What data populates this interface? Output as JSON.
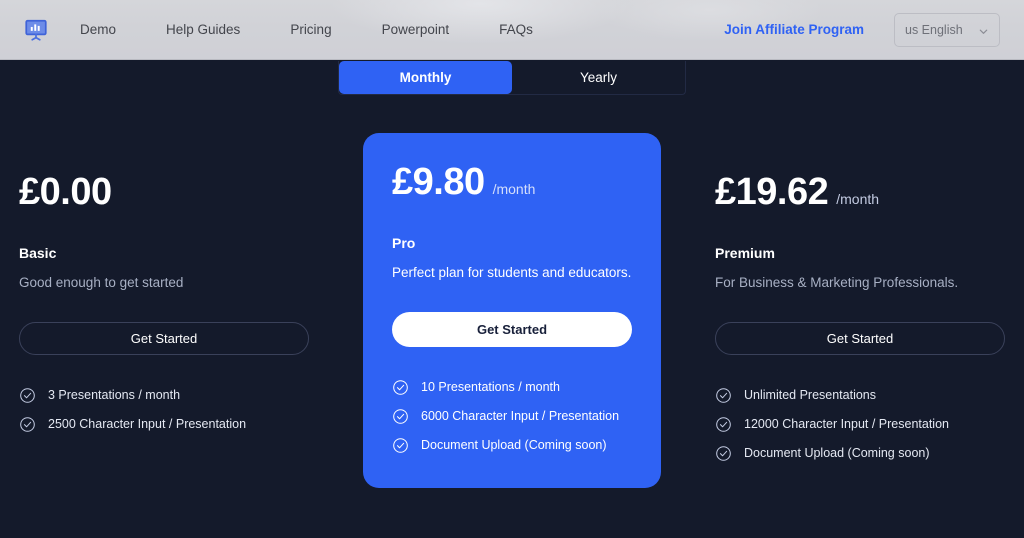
{
  "header": {
    "logo_icon": "presentation-chart-icon",
    "nav_links": [
      {
        "label": "Demo"
      },
      {
        "label": "Help Guides"
      },
      {
        "label": "Pricing"
      },
      {
        "label": "Powerpoint"
      },
      {
        "label": "FAQs"
      }
    ],
    "affiliate_label": "Join Affiliate Program",
    "language": {
      "selected": "us English",
      "chevron_icon": "chevron-down-icon"
    },
    "colors": {
      "background": "#d2d3d8",
      "link": "#43454c",
      "accent": "#2f62f4"
    }
  },
  "billing_toggle": {
    "options": [
      {
        "label": "Monthly",
        "active": true
      },
      {
        "label": "Yearly",
        "active": false
      }
    ]
  },
  "pricing": {
    "check_icon": "check-circle-icon",
    "plans": [
      {
        "price": "£0.00",
        "period": "",
        "name": "Basic",
        "description": "Good enough to get started",
        "cta_label": "Get Started",
        "featured": false,
        "features": [
          "3 Presentations / month",
          "2500 Character Input / Presentation"
        ]
      },
      {
        "price": "£9.80",
        "period": "/month",
        "name": "Pro",
        "description": "Perfect plan for students and educators.",
        "cta_label": "Get Started",
        "featured": true,
        "features": [
          "10 Presentations / month",
          "6000 Character Input / Presentation",
          "Document Upload (Coming soon)"
        ]
      },
      {
        "price": "£19.62",
        "period": "/month",
        "name": "Premium",
        "description": "For Business & Marketing Professionals.",
        "cta_label": "Get Started",
        "featured": false,
        "features": [
          "Unlimited Presentations",
          "12000 Character Input / Presentation",
          "Document Upload (Coming soon)"
        ]
      }
    ]
  },
  "theme": {
    "page_background": "#141a2b",
    "accent": "#2f62f4"
  }
}
